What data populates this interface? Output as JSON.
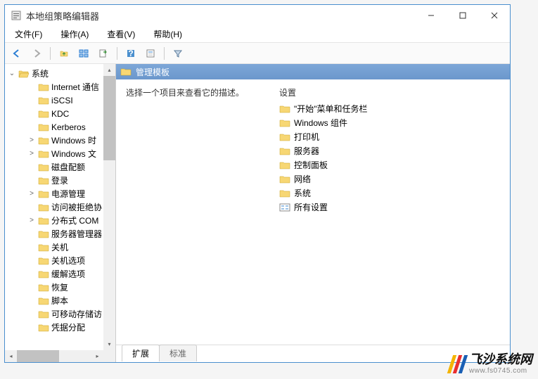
{
  "window": {
    "title": "本地组策略编辑器",
    "buttons": {
      "min": "—",
      "max": "☐",
      "close": "✕"
    }
  },
  "menubar": [
    "文件(F)",
    "操作(A)",
    "查看(V)",
    "帮助(H)"
  ],
  "toolbar_icons": [
    "back",
    "forward",
    "up",
    "view-list",
    "export",
    "help",
    "props",
    "filter"
  ],
  "tree": {
    "root": {
      "label": "系统",
      "expanded": true
    },
    "children": [
      {
        "label": "Internet 通信",
        "expand": ""
      },
      {
        "label": "iSCSI",
        "expand": ""
      },
      {
        "label": "KDC",
        "expand": ""
      },
      {
        "label": "Kerberos",
        "expand": ""
      },
      {
        "label": "Windows 时",
        "expand": ">"
      },
      {
        "label": "Windows 文",
        "expand": ">"
      },
      {
        "label": "磁盘配额",
        "expand": ""
      },
      {
        "label": "登录",
        "expand": ""
      },
      {
        "label": "电源管理",
        "expand": ">"
      },
      {
        "label": "访问被拒绝协",
        "expand": ""
      },
      {
        "label": "分布式 COM",
        "expand": ">"
      },
      {
        "label": "服务器管理器",
        "expand": ""
      },
      {
        "label": "关机",
        "expand": ""
      },
      {
        "label": "关机选项",
        "expand": ""
      },
      {
        "label": "缓解选项",
        "expand": ""
      },
      {
        "label": "恢复",
        "expand": ""
      },
      {
        "label": "脚本",
        "expand": ""
      },
      {
        "label": "可移动存储访",
        "expand": ""
      },
      {
        "label": "凭据分配",
        "expand": ""
      }
    ]
  },
  "header": {
    "title": "管理模板"
  },
  "description": "选择一个项目来查看它的描述。",
  "settings_header": "设置",
  "settings": [
    {
      "label": "\"开始\"菜单和任务栏",
      "icon": "folder"
    },
    {
      "label": "Windows 组件",
      "icon": "folder"
    },
    {
      "label": "打印机",
      "icon": "folder"
    },
    {
      "label": "服务器",
      "icon": "folder"
    },
    {
      "label": "控制面板",
      "icon": "folder"
    },
    {
      "label": "网络",
      "icon": "folder"
    },
    {
      "label": "系统",
      "icon": "folder"
    },
    {
      "label": "所有设置",
      "icon": "all"
    }
  ],
  "tabs": {
    "extended": "扩展",
    "standard": "标准"
  },
  "watermark": {
    "main": "飞沙系统网",
    "sub": "www.fs0745.com"
  },
  "colors": {
    "stripe1": "#f4b400",
    "stripe2": "#ea2e2e",
    "stripe3": "#1a5fb4"
  }
}
